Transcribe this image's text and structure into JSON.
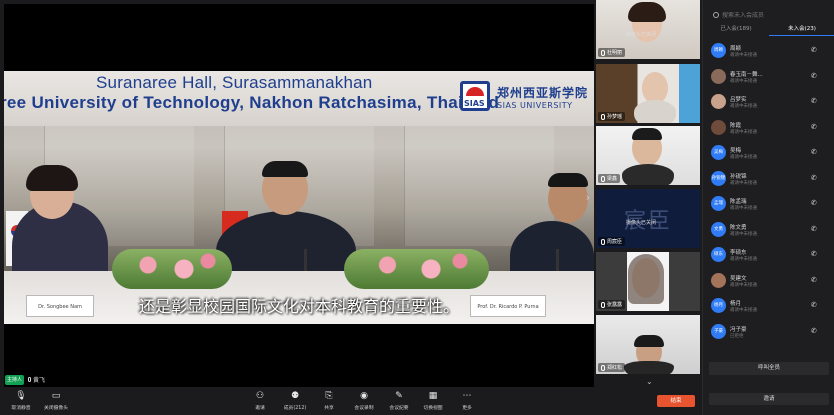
{
  "stage": {
    "banner_line1": "Suranaree Hall, Surasammanakhan",
    "banner_line2": "ree University of Technology, Nakhon Ratchasima, Thailand",
    "logo_abbr": "SIAS",
    "logo_cn": "郑州西亚斯学院",
    "logo_en": "SIAS UNIVERSITY",
    "nameplate_left": "Dr. Songbee Nam",
    "nameplate_right": "Prof. Dr. Ricardo P. Purna",
    "subtitle": "还是彰显校园国际文化对本科教育的重要性。",
    "host_badge": "主持人",
    "host_name": "黄飞"
  },
  "thumbs": [
    {
      "name": "杜明丽",
      "status": "摄像头已关闭"
    },
    {
      "name": "孙梦瑶",
      "status": ""
    },
    {
      "name": "梁鑫",
      "status": ""
    },
    {
      "name": "周宸臣",
      "status": "摄像头已关闭",
      "placeholder": "宸臣"
    },
    {
      "name": "张露露",
      "status": ""
    },
    {
      "name": "郑红松",
      "status": ""
    }
  ],
  "side": {
    "search_placeholder": "搜索未入会成员",
    "tab_joined": "已入会(189)",
    "tab_not_joined": "未入会(23)",
    "participants": [
      {
        "avatar": "周颖",
        "name": "周颖",
        "status": "邀请中未接通"
      },
      {
        "avatar": "",
        "name": "春玉南－舞...",
        "status": "邀请中未接通",
        "photo": true
      },
      {
        "avatar": "",
        "name": "吕梦实",
        "status": "邀请中未接通",
        "photo": true
      },
      {
        "avatar": "",
        "name": "陈霞",
        "status": "邀请中未接通",
        "photo": true
      },
      {
        "avatar": "吴梅",
        "name": "吴梅",
        "status": "邀请中未接通"
      },
      {
        "avatar": "孙锐锦",
        "name": "孙锐锦",
        "status": "邀请中未接通"
      },
      {
        "avatar": "孟瑞",
        "name": "陈孟瑞",
        "status": "邀请中未接通"
      },
      {
        "avatar": "文勇",
        "name": "陈文勇",
        "status": "邀请中未接通"
      },
      {
        "avatar": "硕东",
        "name": "李硕东",
        "status": "邀请中未接通"
      },
      {
        "avatar": "",
        "name": "吴建文",
        "status": "邀请中未接通",
        "photo": true
      },
      {
        "avatar": "杨月",
        "name": "杨月",
        "status": "邀请中未接通"
      },
      {
        "avatar": "子豪",
        "name": "冯子豪",
        "status": "已拒绝"
      }
    ],
    "call_all": "呼叫全员",
    "invite": "邀请"
  },
  "toolbar": {
    "mute": "取消静音",
    "camera": "关闭摄像头",
    "invite": "邀请",
    "members": "成员(212)",
    "share": "共享",
    "record": "会议录制",
    "minutes": "会议纪要",
    "layout": "切换视图",
    "more": "更多",
    "end": "结束"
  },
  "colors": {
    "accent": "#2f7cf6",
    "end_button": "#e8542f",
    "host_badge": "#14a052"
  }
}
